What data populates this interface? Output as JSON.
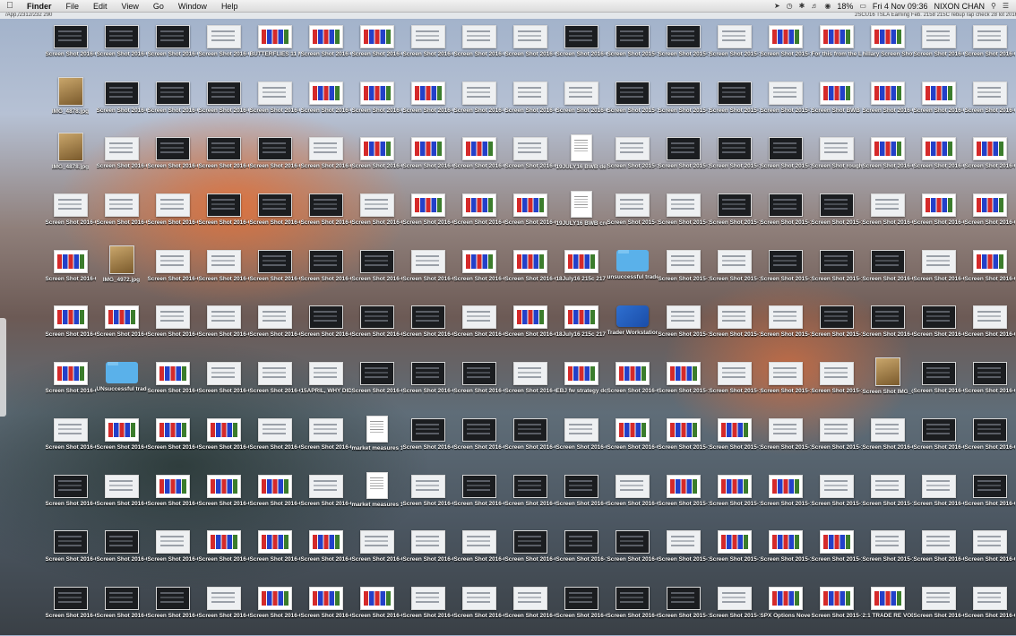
{
  "menubar": {
    "app_name": "Finder",
    "menus": [
      "File",
      "Edit",
      "View",
      "Go",
      "Window",
      "Help"
    ],
    "battery": "18%",
    "clock": "Fri 4 Nov  09:36",
    "user": "NIXON CHAN"
  },
  "path_bar": {
    "left": "/App,/2312/232 290",
    "right": "2SCU16 TSLA Earning Feb. 2158 215C rebup rap check 28 lot 2016"
  },
  "desktop": {
    "icons": [
      [
        "Screen Shot 2016-0...0.58 PM",
        "Screen Shot 2016-0...6.47 PM",
        "Screen Shot 2016-0...9.45 PM",
        "Screen Shot 2016-0...1.44 PM",
        "BUTTERFLIES 11 MAY15.mov",
        "Screen Shot 2016-0...7.31 PM",
        "Screen Shot 2016-0...2.09 AM",
        "Screen Shot 2016-0...3.15 PM",
        "Screen Shot 2016-0...6.29 PM",
        "Screen Shot 2016-0...2.41 PM",
        "Screen Shot 2016-0...3.44 PM",
        "Screen Shot 2015-1...9.03 pm",
        "Screen Shot 2015-1...8.19 AM",
        "Screen Shot 2015-1...2.10 PM",
        "Screen Shot 2015-1...2.59 PM",
        "For this from the LFZs JKY show... FAQ.mov",
        "hillary Screen Shot 2016-0...4.21 PM",
        "Screen Shot 2016-0...8.36 PM",
        "Screen Shot 2016-0...4.47 PM"
      ],
      [
        "IMG_4878.jpg",
        "Screen Shot 2016-0...4.46 PM",
        "Screen Shot 2016-0...5.18 PM",
        "Screen Shot 2016-0...4.35 PM",
        "Screen Shot 2016-0...3.35 PM",
        "Screen Shot 2016-0...7.26 PM",
        "Screen Shot 2016-0...5.45 PM",
        "Screen Shot 2016-0...6.07 PM",
        "Screen Shot 2016-0...0.03 PM",
        "Screen Shot 2016-0...8.45 PM",
        "Screen Shot 2016-0...1.10 PM",
        "Screen Shot 2015-1...5.05 pm",
        "Screen Shot 2015-1...5.56 PM",
        "Screen Shot 2015-1...2.02 PM",
        "Screen Shot 2015-1...2.21 PM",
        "Screen Shot BWB 14dec15",
        "Screen Shot 2016-0...4.18 PM",
        "Screen Shot 2016-0...8.42 PM",
        "Screen Shot 2016-0...6.21 PM"
      ],
      [
        "IMG_4878.jpg",
        "Screen Shot 2016-0...4.40 PM",
        "Screen Shot 2016-0...1.42 PM",
        "Screen Shot 2016-0...4.22 PM",
        "Screen Shot 2016-0...1.15 PM",
        "Screen Shot 2016-0...7.12 PM",
        "Screen Shot 2016-0...2.26 PM",
        "Screen Shot 2016-0...6.07 PM",
        "Screen Shot 2016-0...37.17 PM",
        "Screen Shot 2016-0...0.45 PM",
        "19JULY16 BWB debit 1/...ax profit",
        "Screen Shot 2015-1...3.25 pm",
        "Screen Shot 2015-1...2.13 PM",
        "Screen Shot 2015-1...4.46 PM",
        "Screen Shot 2015-1...2.27 PM",
        "Screen Shot rough BWB 14dec15",
        "Screen Shot 2016-0...7.29 PM",
        "Screen Shot 2016-0...2.01 PM",
        "Screen Shot 2016-0...6.03 PM"
      ],
      [
        "Screen Shot 2016-0...0.51 PM",
        "Screen Shot 2016-0...1.27 PM",
        "Screen Shot 2016-0...1.36 PM",
        "Screen Shot 2016-0...4.29 PM",
        "Screen Shot 2016-0...5.28 PM",
        "Screen Shot 2016-0...7.08 PM",
        "Screen Shot 2016-0...5.29 PM",
        "Screen Shot 2016-0...4.08 PM",
        "Screen Shot 2016-0...0.46 AM",
        "Screen Shot 2016-0...5.34 PM",
        "19JULY16 BWB credit s...1 month",
        "Screen Shot 2015-1...9.58 pm",
        "Screen Shot 2015-11...5.58 PM",
        "Screen Shot 2015-11...6.04 PM",
        "Screen Shot 2015-1...6.45 AM",
        "Screen Shot 2015-1...4.07 PM",
        "Screen Shot 2016-0...1.00 PM",
        "Screen Shot 2016-0...3.22 PM",
        "Screen Shot 2016-0...4.07 PM"
      ],
      [
        "Screen Shot 2016-0...7.28 PM",
        "IMG_4972.jpg",
        "Screen Shot 2016-0...6.08 PM",
        "Screen Shot 2016-0...8.18 PM",
        "Screen Shot 2016-0...6.31 PM",
        "Screen Shot 2016-0...2.10 PM",
        "Screen Shot 2016-0...0.23 PM",
        "Screen Shot 2016-0...0.26 PM",
        "Screen Shot 2016-0...2.16 PM",
        "Screen Shot 2016-0...3.14 PM",
        "18July16 215c 217 222 BWB - ill",
        "unsuccessful trades",
        "Screen Shot 2015-11...56 PM",
        "Screen Shot 2015-11...3.19 PM",
        "Screen Shot 2015-1...7.20 PM",
        "Screen Shot 2015-1...7.28 PM",
        "Screen Shot 2016-0...0.48 PM",
        "Screen Shot 2016-0...5.25 AM",
        "Screen Shot 2016-0...3.49 PM"
      ],
      [
        "Screen Shot 2016-0...5.20 PM",
        "Screen Shot 2016-0...7.52 PM",
        "Screen Shot 2016-0...4.25 PM",
        "Screen Shot 2016-0...7.48 PM",
        "Screen Shot 2016-0...3.20 PM",
        "Screen Shot 2016-0...4.56 PM",
        "Screen Shot 2016-0...5.46 PM",
        "Screen Shot 2016-0...5.22 PM",
        "Screen Shot 2016-0...8.26 PM",
        "Screen Shot 2016-0...0.03 PM",
        "18July16 215c 217 222...8 dough",
        "Trader Workstation",
        "Screen Shot 2015-1...5.57 PM",
        "Screen Shot 2015-1...1.40 PM",
        "Screen Shot 2015-1...2.21 PM",
        "Screen Shot 2015-1...57.18 PM",
        "Screen Shot 2016-0...0.39 PM",
        "Screen Shot 2016-0...11.14 AM",
        "Screen Shot 2016-0...0.40 PM"
      ],
      [
        "Screen Shot 2016-0...5.14 PM",
        "UNsuccessful trades",
        "Screen Shot 2016-0...6.05 PM",
        "Screen Shot 2016-0...7.39 PM",
        "Screen Shot 2016-0...0.17 PM",
        "15APRIL, WHY DID IT TRIGGER?",
        "Screen Shot 2016-0...9.03 PM",
        "Screen Shot 2016-0...5.51 PM",
        "Screen Shot 2016-0...8.10 AM",
        "Screen Shot 2016-0...6.42 PM",
        "EBJ fw strategy done with profit",
        "Screen Shot 2016-0...6.16 PM",
        "Screen Shot 2015-1...0.13 PM",
        "Screen Shot 2015-1...2.41 PM",
        "Screen Shot 2015-1...3.18 PM",
        "Screen Shot 2015-1...9.03 PM",
        "Screen Shot IMG_0032.jpg",
        "Screen Shot 2016-0...1.56 PM",
        "Screen Shot 2016-0...4.19 PM"
      ],
      [
        "Screen Shot 2016-0...0.09 PM",
        "Screen Shot 2016-0...2.48 PM",
        "Screen Shot 2016-0...3.37 PM",
        "Screen Shot 2016-0...7.12 PM",
        "Screen Shot 2016-0...9.07 PM",
        "Screen Shot 2016-0...17.13 PM",
        "market measures 15apr16...ments",
        "Screen Shot 2016-0...0.39 PM",
        "Screen Shot 2016-0...4.22 PM",
        "Screen Shot 2016-0...4.01 PM",
        "Screen Shot 2016-0...1.44 PM",
        "Screen Shot 2016-0...2.51 PM",
        "Screen Shot 2015-1...8.25 PM",
        "Screen Shot 2015-11...35 PM",
        "Screen Shot 2015-1...25 PM",
        "Screen Shot 2015-1...31.21 PM",
        "Screen Shot 2016-0...0.40 PM",
        "Screen Shot 2016-0...1.30 PM",
        "Screen Shot 2016-0...8.55 PM"
      ],
      [
        "Screen Shot 2016-0...6.11 PM",
        "Screen Shot 2016-0...6.03 PM",
        "Screen Shot 2016-0...5.53 PM",
        "Screen Shot 2016-0...8.27 PM",
        "Screen Shot 2016-0...7.44 PM",
        "Screen Shot 2016-0...4.01 PM",
        "market measures 15apr16...ments",
        "Screen Shot 2016-0...4.59 PM",
        "Screen Shot 2016-0...7.29 PM",
        "Screen Shot 2016-0...9.32 PM",
        "Screen Shot 2016-0...9.30 PM",
        "Screen Shot 2016-0...5.33 PM",
        "Screen Shot 2015-1...59.17 PM",
        "Screen Shot 2015-11...1.41 PM",
        "Screen Shot 2015-1...2.21 PM",
        "Screen Shot 2015-1...7.05 PM",
        "Screen Shot 2015-1...8.22 PM",
        "Screen Shot 2016-0...5.52 AM",
        "Screen Shot 2016-0...4.07 PM"
      ],
      [
        "Screen Shot 2016-0...5.40 PM",
        "Screen Shot 2016-0...1.51 PM",
        "Screen Shot 2016-0...4.50 PM",
        "Screen Shot 2016-0...2.02 PM",
        "Screen Shot 2016-0...3.09 PM",
        "Screen Shot 2016-0...5.16 PM",
        "Screen Shot 2016-0...2.02 PM",
        "Screen Shot 2016-0...4.37 PM",
        "Screen Shot 2016-0...5.24 PM",
        "Screen Shot 2016-0...4.21 PM",
        "Screen Shot 2016-1...7.21 PM",
        "Screen Shot 2016-0...9.04 PM",
        "Screen Shot 2015-1...6.36 PM",
        "Screen Shot 2015-11...5.37 PM",
        "Screen Shot 2015-11...45 PM",
        "Screen Shot 2015-1...13.13 PM",
        "Screen Shot 2015-1...8.17 PM",
        "Screen Shot 2016-0...3.53 AM",
        "Screen Shot 2016-0...2.07 PM"
      ],
      [
        "Screen Shot 2016-0...0.33 PM",
        "Screen Shot 2016-0...3.56 PM",
        "Screen Shot 2016-0...2.35 PM",
        "Screen Shot 2016-0...6.29 PM",
        "Screen Shot 2016-0...1.41 PM",
        "Screen Shot 2016-0...8.21 PM",
        "Screen Shot 2016-0...9.02 PM",
        "Screen Shot 2016-0...5.29 PM",
        "Screen Shot 2016-0...4.12 PM",
        "Screen Shot 2016-0...1.05 PM",
        "Screen Shot 2016-0...9.39 PM",
        "Screen Shot 2016-0...0.38 PM",
        "Screen Shot 2015-1...8.19 PM",
        "Screen Shot 2015-11...24 PM",
        "SPX Options Novem...ads.mov",
        "Screen Shot 2015-1...4.39 PM",
        "2:1 TRADE RE VOD_579.mov",
        "Screen Shot 2016-0...6.53 PM",
        "Screen Shot 2016-0...4.40 PM"
      ]
    ]
  }
}
